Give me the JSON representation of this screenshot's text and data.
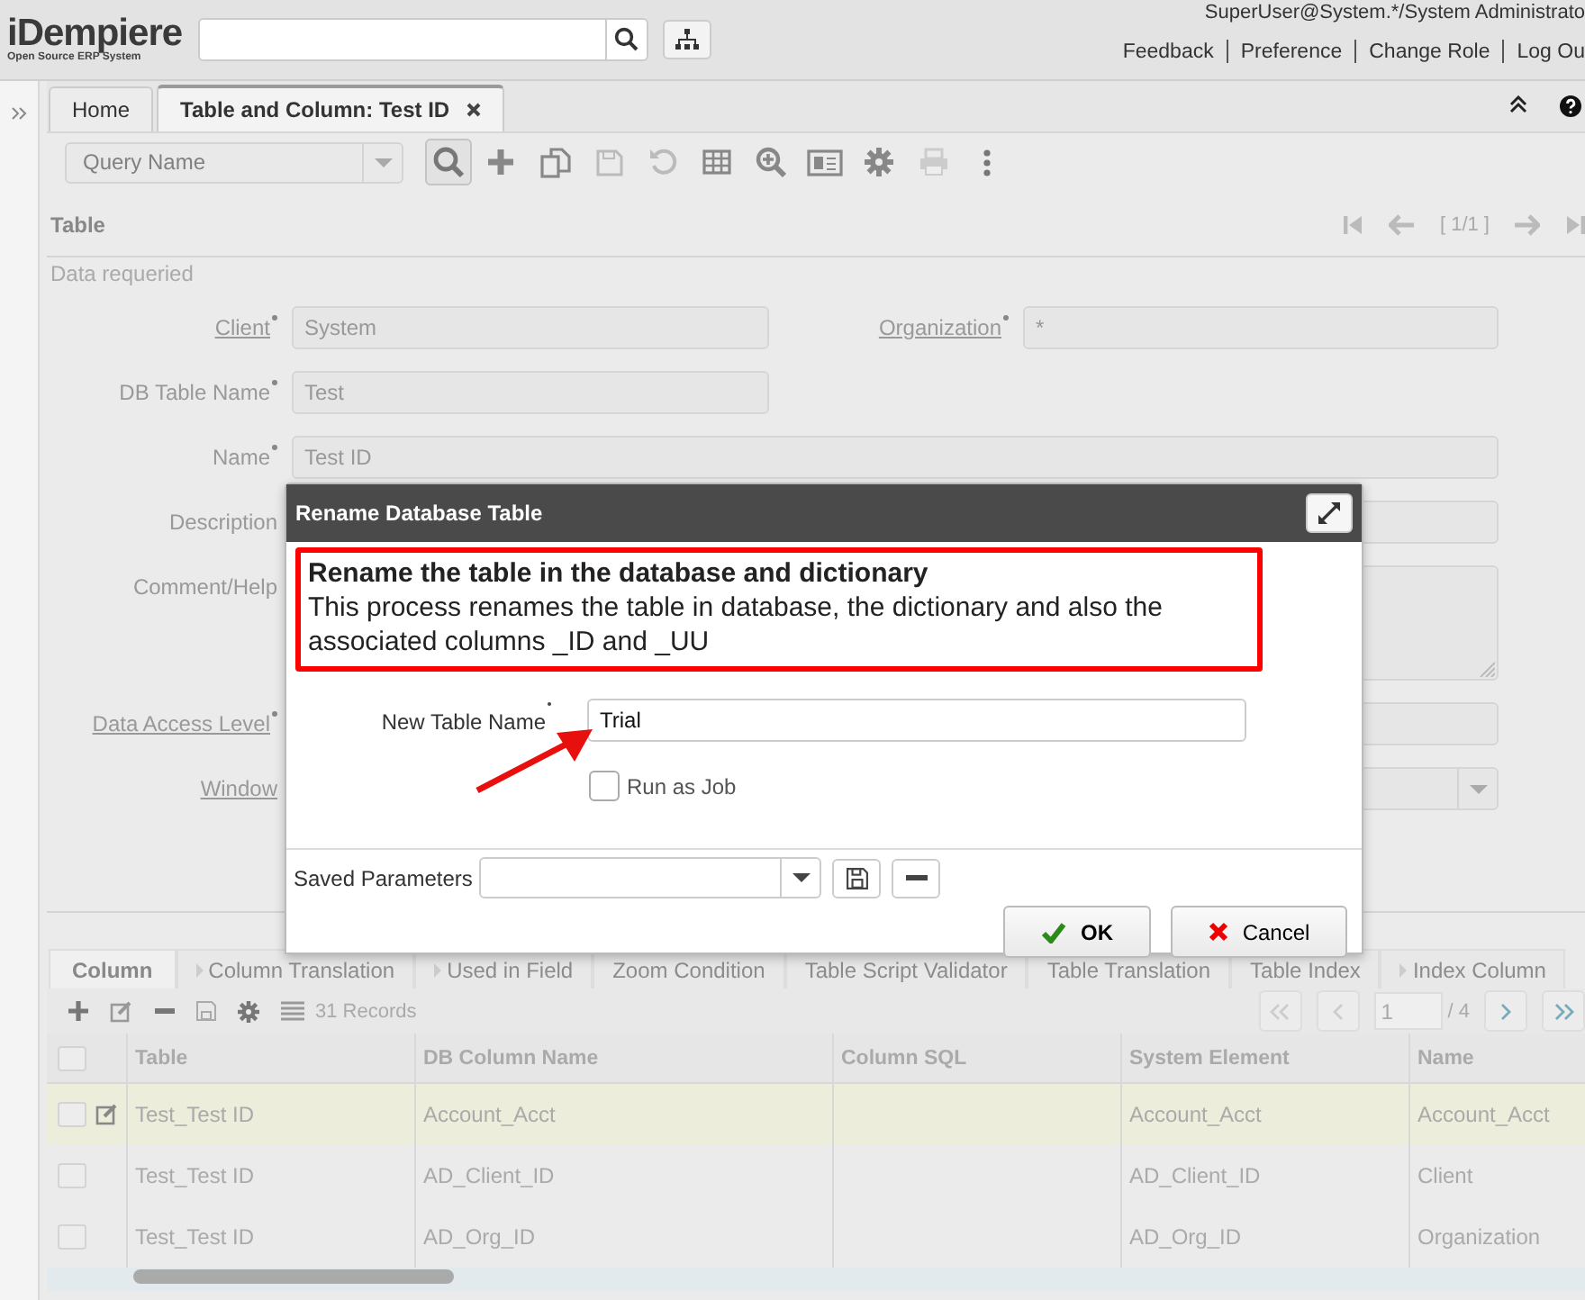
{
  "header": {
    "logo": "iDempiere",
    "tagline": "Open Source ERP System",
    "user": "SuperUser@System.*/System Administrato",
    "links": [
      "Feedback",
      "Preference",
      "Change Role",
      "Log Ou"
    ]
  },
  "window_tabs": [
    {
      "label": "Home",
      "selected": false,
      "closable": false
    },
    {
      "label": "Table and Column: Test ID",
      "selected": true,
      "closable": true
    }
  ],
  "toolbar": {
    "query_placeholder": "Query Name"
  },
  "section": {
    "title": "Table",
    "status": "Data requeried",
    "record_position": "[ 1/1 ]"
  },
  "form_rows": [
    [
      {
        "kind": "text",
        "label": "Client",
        "link": true,
        "mandatory": true,
        "value": "System"
      },
      {
        "kind": "text",
        "label": "Organization",
        "link": true,
        "mandatory": true,
        "value": "*"
      }
    ],
    [
      {
        "kind": "text",
        "label": "DB Table Name",
        "link": false,
        "mandatory": true,
        "value": "Test"
      }
    ],
    [
      {
        "kind": "wide",
        "label": "Name",
        "link": false,
        "mandatory": true,
        "value": "Test ID"
      }
    ],
    [
      {
        "kind": "wide",
        "label": "Description",
        "link": false,
        "mandatory": false
      }
    ],
    [
      {
        "kind": "textarea",
        "label": "Comment/Help",
        "link": false,
        "mandatory": false
      }
    ],
    [
      {
        "kind": "wide",
        "label": "Data Access Level",
        "link": true,
        "mandatory": true
      }
    ],
    [
      {
        "kind": "combo",
        "label": "Window",
        "link": true,
        "mandatory": false
      }
    ]
  ],
  "dialog": {
    "title": "Rename Database Table",
    "heading": "Rename the table in the database and dictionary",
    "description": "This process renames the table in database, the dictionary and also the associated columns _ID and _UU",
    "param_label": "New Table Name",
    "param_mandatory": true,
    "param_value": "Trial",
    "run_as_job": {
      "label": "Run as Job",
      "checked": false
    },
    "saved_label": "Saved Parameters",
    "buttons": [
      {
        "kind": "ok",
        "label": "OK"
      },
      {
        "kind": "cancel",
        "label": "Cancel"
      }
    ]
  },
  "detail": {
    "tabs": [
      {
        "label": "Column",
        "selected": true,
        "has_children": false
      },
      {
        "label": "Column Translation",
        "selected": false,
        "has_children": true
      },
      {
        "label": "Used in Field",
        "selected": false,
        "has_children": true
      },
      {
        "label": "Zoom Condition",
        "selected": false,
        "has_children": false
      },
      {
        "label": "Table Script Validator",
        "selected": false,
        "has_children": false
      },
      {
        "label": "Table Translation",
        "selected": false,
        "has_children": false
      },
      {
        "label": "Table Index",
        "selected": false,
        "has_children": false
      },
      {
        "label": "Index Column",
        "selected": false,
        "has_children": true
      }
    ],
    "all_selected": false,
    "records": "31 Records",
    "page": "1",
    "page_total": "/ 4",
    "columns": [
      "Table",
      "DB Column Name",
      "Column SQL",
      "System Element",
      "Name"
    ],
    "rows": [
      {
        "selected": true,
        "table": "Test_Test ID",
        "db_column_name": "Account_Acct",
        "system_element": "Account_Acct",
        "name": "Account_Acct"
      },
      {
        "selected": false,
        "table": "Test_Test ID",
        "db_column_name": "AD_Client_ID",
        "system_element": "AD_Client_ID",
        "name": "Client"
      },
      {
        "selected": false,
        "table": "Test_Test ID",
        "db_column_name": "AD_Org_ID",
        "system_element": "AD_Org_ID",
        "name": "Organization"
      }
    ]
  }
}
